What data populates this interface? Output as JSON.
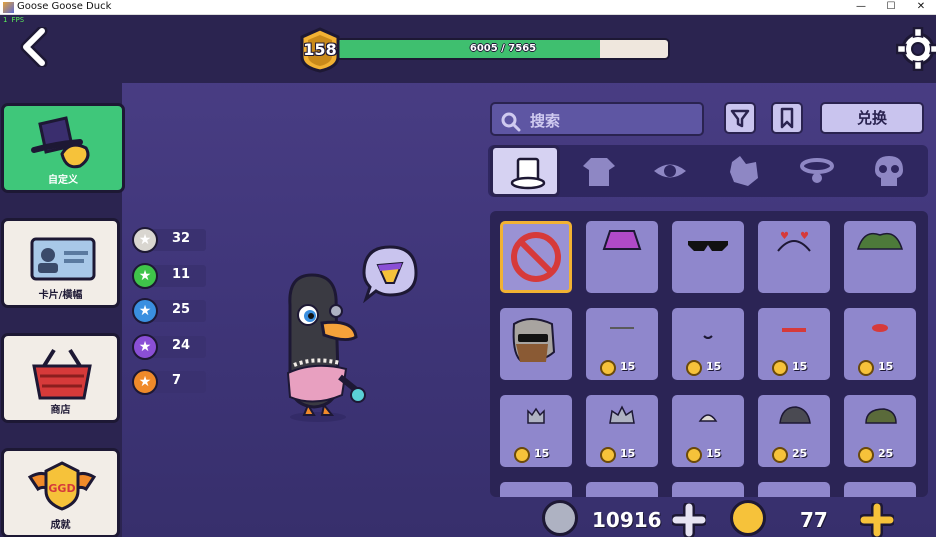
{
  "window": {
    "title": "Goose Goose Duck",
    "min": "—",
    "max": "☐",
    "close": "✕"
  },
  "fps": "1 FPS",
  "level": {
    "number": "158",
    "text": "6005 / 7565",
    "progress": 0.794
  },
  "nav": [
    {
      "label": "自定义",
      "icon": "top-hat-glove-icon",
      "active": true
    },
    {
      "label": "卡片/横幅",
      "icon": "id-card-icon",
      "active": false
    },
    {
      "label": "商店",
      "icon": "shopping-basket-icon",
      "active": false
    },
    {
      "label": "成就",
      "icon": "ggd-badge-icon",
      "active": false
    }
  ],
  "stars": [
    {
      "count": "32",
      "color": "#d9d6d0"
    },
    {
      "count": "11",
      "color": "#3fc44a"
    },
    {
      "count": "25",
      "color": "#3a8fe0"
    },
    {
      "count": "24",
      "color": "#8a4fd6"
    },
    {
      "count": "7",
      "color": "#f08a2a"
    }
  ],
  "search": {
    "placeholder": "搜索"
  },
  "redeem": "兑换",
  "categories": [
    {
      "name": "hat-icon",
      "active": true
    },
    {
      "name": "outfit-icon",
      "active": false
    },
    {
      "name": "eye-icon",
      "active": false
    },
    {
      "name": "pet-icon",
      "active": false
    },
    {
      "name": "collar-icon",
      "active": false
    },
    {
      "name": "skull-icon",
      "active": false
    }
  ],
  "items": [
    {
      "name": "none",
      "price": ""
    },
    {
      "name": "purple-bucket-hat",
      "price": ""
    },
    {
      "name": "pixel-sunglasses",
      "price": ""
    },
    {
      "name": "heart-headband",
      "price": ""
    },
    {
      "name": "leafy-camo",
      "price": ""
    },
    {
      "name": "gray-hair-beard-sunglasses",
      "price": ""
    },
    {
      "name": "small-accessory-1",
      "price": "15"
    },
    {
      "name": "small-accessory-2",
      "price": "15"
    },
    {
      "name": "red-mouth",
      "price": "15"
    },
    {
      "name": "red-blob",
      "price": "15"
    },
    {
      "name": "silver-crown",
      "price": "15"
    },
    {
      "name": "silver-tiara",
      "price": "15"
    },
    {
      "name": "small-tiara",
      "price": "15"
    },
    {
      "name": "dark-helmet",
      "price": "25"
    },
    {
      "name": "army-cap",
      "price": "25"
    }
  ],
  "currency": {
    "silver": "10916",
    "gold": "77"
  }
}
